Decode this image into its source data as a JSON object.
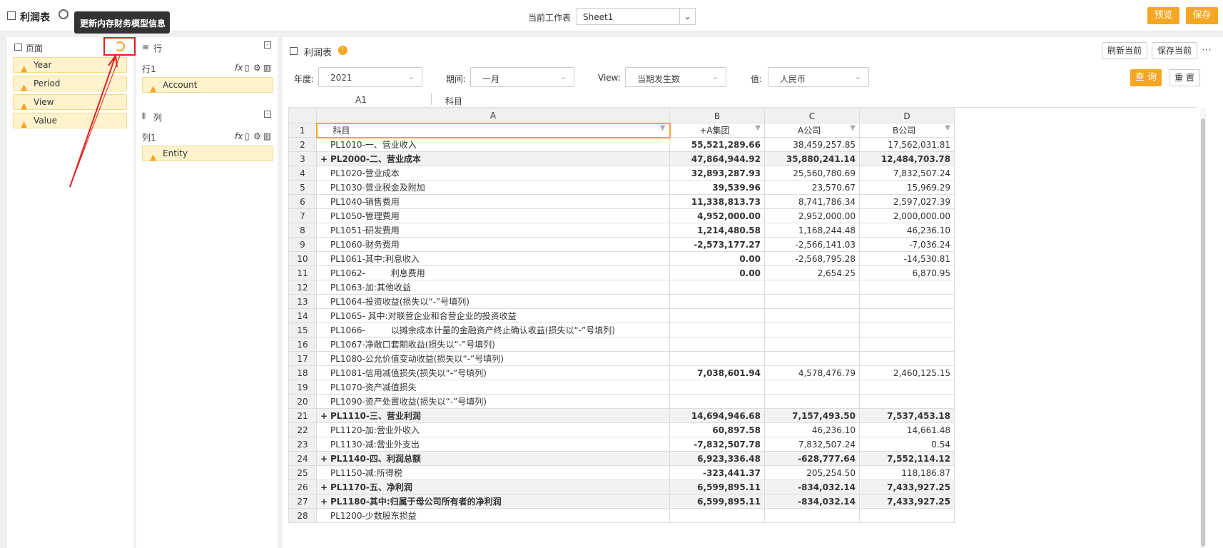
{
  "header": {
    "title": "利润表",
    "tooltip": "更新内存财务模型信息",
    "current_sheet_label": "当前工作表",
    "current_sheet_value": "Sheet1",
    "preview_label": "预览",
    "save_label": "保存"
  },
  "pages_panel": {
    "title": "页面",
    "items": [
      "Year",
      "Period",
      "View",
      "Value"
    ]
  },
  "rows_panel": {
    "title": "行",
    "row_label": "行1",
    "row_item": "Account",
    "cols_title": "列",
    "col_label": "列1",
    "col_item": "Entity",
    "fx": "fx"
  },
  "report": {
    "title": "利润表",
    "refresh_current": "刷新当前",
    "save_current": "保存当前",
    "more": "⋯",
    "filters": {
      "year_label": "年度:",
      "year_value": "2021",
      "period_label": "期间:",
      "period_value": "一月",
      "view_label": "View:",
      "view_value": "当期发生数",
      "value_label": "值:",
      "value_value": "人民币"
    },
    "query_label": "查 询",
    "reset_label": "重 置",
    "cell_ref": "A1",
    "cell_content": "科目"
  },
  "grid": {
    "col_headers": [
      "A",
      "B",
      "C",
      "D"
    ],
    "header_row": {
      "rn": "1",
      "a": "科目",
      "b": "+A集团",
      "c": "A公司",
      "d": "B公司"
    },
    "rows": [
      {
        "rn": "2",
        "exp": "",
        "acct": "PL1010-一、营业收入",
        "b": "55,521,289.66",
        "c": "38,459,257.85",
        "d": "17,562,031.81",
        "bold": false,
        "shade": false
      },
      {
        "rn": "3",
        "exp": "+",
        "acct": "PL2000-二、营业成本",
        "b": "47,864,944.92",
        "c": "35,880,241.14",
        "d": "12,484,703.78",
        "bold": true,
        "shade": true
      },
      {
        "rn": "4",
        "exp": "",
        "acct": "PL1020-营业成本",
        "b": "32,893,287.93",
        "c": "25,560,780.69",
        "d": "7,832,507.24",
        "bold": false,
        "shade": false
      },
      {
        "rn": "5",
        "exp": "",
        "acct": "PL1030-营业税金及附加",
        "b": "39,539.96",
        "c": "23,570.67",
        "d": "15,969.29",
        "bold": false,
        "shade": false
      },
      {
        "rn": "6",
        "exp": "",
        "acct": "PL1040-销售费用",
        "b": "11,338,813.73",
        "c": "8,741,786.34",
        "d": "2,597,027.39",
        "bold": false,
        "shade": false
      },
      {
        "rn": "7",
        "exp": "",
        "acct": "PL1050-管理费用",
        "b": "4,952,000.00",
        "c": "2,952,000.00",
        "d": "2,000,000.00",
        "bold": false,
        "shade": false
      },
      {
        "rn": "8",
        "exp": "",
        "acct": "PL1051-研发费用",
        "b": "1,214,480.58",
        "c": "1,168,244.48",
        "d": "46,236.10",
        "bold": false,
        "shade": false
      },
      {
        "rn": "9",
        "exp": "",
        "acct": "PL1060-财务费用",
        "b": "-2,573,177.27",
        "c": "-2,566,141.03",
        "d": "-7,036.24",
        "bold": false,
        "shade": false
      },
      {
        "rn": "10",
        "exp": "",
        "acct": "PL1061-其中:利息收入",
        "b": "0.00",
        "c": "-2,568,795.28",
        "d": "-14,530.81",
        "bold": false,
        "shade": false
      },
      {
        "rn": "11",
        "exp": "",
        "acct": "PL1062-　　　利息费用",
        "b": "0.00",
        "c": "2,654.25",
        "d": "6,870.95",
        "bold": false,
        "shade": false
      },
      {
        "rn": "12",
        "exp": "",
        "acct": "PL1063-加:其他收益",
        "b": "",
        "c": "",
        "d": "",
        "bold": false,
        "shade": false
      },
      {
        "rn": "13",
        "exp": "",
        "acct": "PL1064-投资收益(损失以“-”号填列)",
        "b": "",
        "c": "",
        "d": "",
        "bold": false,
        "shade": false
      },
      {
        "rn": "14",
        "exp": "",
        "acct": "PL1065-  其中:对联营企业和合营企业的投资收益",
        "b": "",
        "c": "",
        "d": "",
        "bold": false,
        "shade": false
      },
      {
        "rn": "15",
        "exp": "",
        "acct": "PL1066-　　　以摊余成本计量的金融资产终止确认收益(损失以“-”号填列)",
        "b": "",
        "c": "",
        "d": "",
        "bold": false,
        "shade": false
      },
      {
        "rn": "16",
        "exp": "",
        "acct": "PL1067-净敞口套期收益(损失以“-”号填列)",
        "b": "",
        "c": "",
        "d": "",
        "bold": false,
        "shade": false
      },
      {
        "rn": "17",
        "exp": "",
        "acct": "PL1080-公允价值变动收益(损失以“-”号填列)",
        "b": "",
        "c": "",
        "d": "",
        "bold": false,
        "shade": false
      },
      {
        "rn": "18",
        "exp": "",
        "acct": "PL1081-信用减值损失(损失以“-”号填列)",
        "b": "7,038,601.94",
        "c": "4,578,476.79",
        "d": "2,460,125.15",
        "bold": false,
        "shade": false
      },
      {
        "rn": "19",
        "exp": "",
        "acct": "PL1070-资产减值损失",
        "b": "",
        "c": "",
        "d": "",
        "bold": false,
        "shade": false
      },
      {
        "rn": "20",
        "exp": "",
        "acct": "PL1090-资产处置收益(损失以“-”号填列)",
        "b": "",
        "c": "",
        "d": "",
        "bold": false,
        "shade": false
      },
      {
        "rn": "21",
        "exp": "+",
        "acct": "PL1110-三、营业利润",
        "b": "14,694,946.68",
        "c": "7,157,493.50",
        "d": "7,537,453.18",
        "bold": true,
        "shade": true
      },
      {
        "rn": "22",
        "exp": "",
        "acct": "PL1120-加:营业外收入",
        "b": "60,897.58",
        "c": "46,236.10",
        "d": "14,661.48",
        "bold": false,
        "shade": false
      },
      {
        "rn": "23",
        "exp": "",
        "acct": "PL1130-减:营业外支出",
        "b": "-7,832,507.78",
        "c": "7,832,507.24",
        "d": "0.54",
        "bold": false,
        "shade": false
      },
      {
        "rn": "24",
        "exp": "+",
        "acct": "PL1140-四、利润总额",
        "b": "6,923,336.48",
        "c": "-628,777.64",
        "d": "7,552,114.12",
        "bold": true,
        "shade": true
      },
      {
        "rn": "25",
        "exp": "",
        "acct": "PL1150-减:所得税",
        "b": "-323,441.37",
        "c": "205,254.50",
        "d": "118,186.87",
        "bold": false,
        "shade": false
      },
      {
        "rn": "26",
        "exp": "+",
        "acct": "PL1170-五、净利润",
        "b": "6,599,895.11",
        "c": "-834,032.14",
        "d": "7,433,927.25",
        "bold": true,
        "shade": true
      },
      {
        "rn": "27",
        "exp": "+",
        "acct": "PL1180-其中:归属于母公司所有者的净利润",
        "b": "6,599,895.11",
        "c": "-834,032.14",
        "d": "7,433,927.25",
        "bold": true,
        "shade": true
      },
      {
        "rn": "28",
        "exp": "",
        "acct": "PL1200-少数股东损益",
        "b": "",
        "c": "",
        "d": "",
        "bold": false,
        "shade": false
      }
    ]
  },
  "colors": {
    "accent": "#f5a623",
    "highlight": "#e02020"
  }
}
